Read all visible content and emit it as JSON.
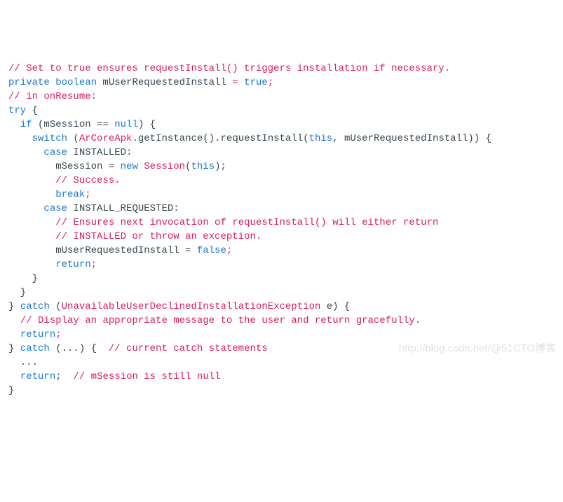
{
  "code": {
    "l0": {
      "a": "// Set to true ensures requestInstall() triggers installation if necessary."
    },
    "l1": {
      "a": "private boolean",
      "b": " mUserRequestedInstall ",
      "c": "=",
      "d": " ",
      "e": "true",
      "f": ";"
    },
    "l2": {
      "a": ""
    },
    "l3": {
      "a": "// in onResume:"
    },
    "l4": {
      "a": "try",
      "b": " {"
    },
    "l5": {
      "a": "  ",
      "b": "if",
      "c": " (mSession == ",
      "d": "null",
      "e": ") {"
    },
    "l6": {
      "a": "    ",
      "b": "switch",
      "c": " (",
      "d": "ArCoreApk",
      "e": ".",
      "f": "getInstance",
      "g": "().",
      "h": "requestInstall",
      "i": "(",
      "j": "this",
      "k": ", mUserRequestedInstall)) {"
    },
    "l7": {
      "a": "      ",
      "b": "case",
      "c": " INSTALLED:"
    },
    "l8": {
      "a": "        mSession = ",
      "b": "new",
      "c": " ",
      "d": "Session",
      "e": "(",
      "f": "this",
      "g": ");"
    },
    "l9": {
      "a": "        ",
      "b": "// Success."
    },
    "l10": {
      "a": "        ",
      "b": "break",
      "c": ";"
    },
    "l11": {
      "a": "      ",
      "b": "case",
      "c": " INSTALL_REQUESTED:"
    },
    "l12": {
      "a": "        ",
      "b": "// Ensures next invocation of requestInstall() will either return"
    },
    "l13": {
      "a": "        ",
      "b": "// INSTALLED or throw an exception."
    },
    "l14": {
      "a": "        mUserRequestedInstall = ",
      "b": "false",
      "c": ";"
    },
    "l15": {
      "a": "        ",
      "b": "return",
      "c": ";"
    },
    "l16": {
      "a": "    }"
    },
    "l17": {
      "a": "  }"
    },
    "l18": {
      "a": "} ",
      "b": "catch",
      "c": " (",
      "d": "UnavailableUserDeclinedInstallationException",
      "e": " e) {"
    },
    "l19": {
      "a": "  ",
      "b": "// Display an appropriate message to the user and return gracefully."
    },
    "l20": {
      "a": "  ",
      "b": "return",
      "c": ";"
    },
    "l21": {
      "a": "} ",
      "b": "catch",
      "c": " (...) {  ",
      "d": "// current catch statements"
    },
    "l22": {
      "a": "  ..."
    },
    "l23": {
      "a": "  ",
      "b": "return",
      "c": ";  ",
      "d": "// mSession is still null"
    },
    "l24": {
      "a": "}"
    }
  },
  "watermark": "http://blog.csdn.net/@51CTO博客"
}
